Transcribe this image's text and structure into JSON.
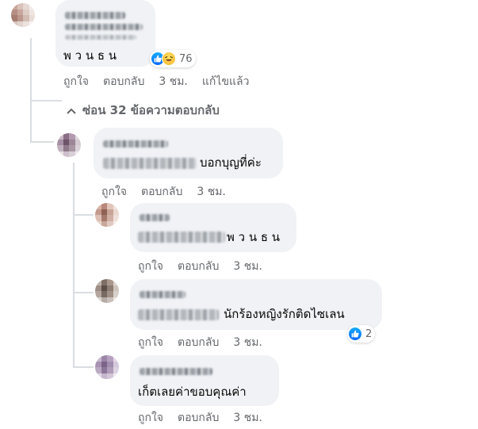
{
  "comment_main": {
    "text": "พ ว น ธ น",
    "reaction_count": "76",
    "actions": {
      "like": "ถูกใจ",
      "reply": "ตอบกลับ",
      "time": "3 ชม.",
      "edited": "แก้ไขแล้ว"
    }
  },
  "hide_replies": {
    "label": "ซ่อน 32 ข้อความตอบกลับ"
  },
  "replies": [
    {
      "text": "บอกบุญที่ค่ะ",
      "actions": {
        "like": "ถูกใจ",
        "reply": "ตอบกลับ",
        "time": "3 ชม."
      }
    },
    {
      "text": "พ ว น ธ น",
      "actions": {
        "like": "ถูกใจ",
        "reply": "ตอบกลับ",
        "time": "3 ชม."
      }
    },
    {
      "text": "นักร้องหญิงรักติดไซเลน",
      "reaction_count": "2",
      "actions": {
        "like": "ถูกใจ",
        "reply": "ตอบกลับ",
        "time": "3 ชม."
      }
    },
    {
      "text": "เก็ตเลยค่าขอบคุณค่า",
      "actions": {
        "like": "ถูกใจ",
        "reply": "ตอบกลับ",
        "time": "3 ชม."
      }
    }
  ],
  "colors": {
    "bubble": "#f0f2f5",
    "meta": "#65676b",
    "like_blue": "#0866ff",
    "line": "#dadde1"
  },
  "icons": {
    "like": "thumbs-up-icon",
    "haha": "haha-icon",
    "chevron": "chevron-up-icon"
  }
}
